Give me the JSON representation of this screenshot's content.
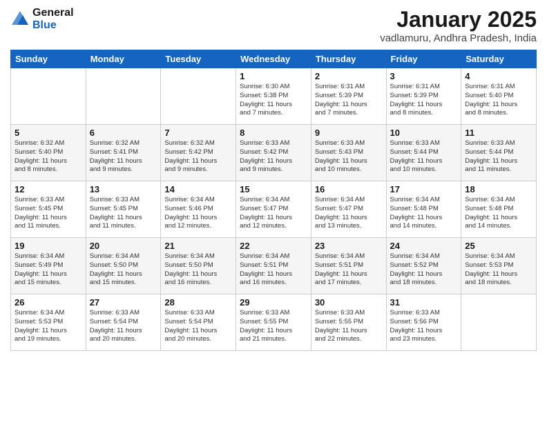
{
  "header": {
    "logo_line1": "General",
    "logo_line2": "Blue",
    "month": "January 2025",
    "location": "vadlamuru, Andhra Pradesh, India"
  },
  "weekdays": [
    "Sunday",
    "Monday",
    "Tuesday",
    "Wednesday",
    "Thursday",
    "Friday",
    "Saturday"
  ],
  "weeks": [
    [
      {
        "day": "",
        "info": ""
      },
      {
        "day": "",
        "info": ""
      },
      {
        "day": "",
        "info": ""
      },
      {
        "day": "1",
        "info": "Sunrise: 6:30 AM\nSunset: 5:38 PM\nDaylight: 11 hours\nand 7 minutes."
      },
      {
        "day": "2",
        "info": "Sunrise: 6:31 AM\nSunset: 5:39 PM\nDaylight: 11 hours\nand 7 minutes."
      },
      {
        "day": "3",
        "info": "Sunrise: 6:31 AM\nSunset: 5:39 PM\nDaylight: 11 hours\nand 8 minutes."
      },
      {
        "day": "4",
        "info": "Sunrise: 6:31 AM\nSunset: 5:40 PM\nDaylight: 11 hours\nand 8 minutes."
      }
    ],
    [
      {
        "day": "5",
        "info": "Sunrise: 6:32 AM\nSunset: 5:40 PM\nDaylight: 11 hours\nand 8 minutes."
      },
      {
        "day": "6",
        "info": "Sunrise: 6:32 AM\nSunset: 5:41 PM\nDaylight: 11 hours\nand 9 minutes."
      },
      {
        "day": "7",
        "info": "Sunrise: 6:32 AM\nSunset: 5:42 PM\nDaylight: 11 hours\nand 9 minutes."
      },
      {
        "day": "8",
        "info": "Sunrise: 6:33 AM\nSunset: 5:42 PM\nDaylight: 11 hours\nand 9 minutes."
      },
      {
        "day": "9",
        "info": "Sunrise: 6:33 AM\nSunset: 5:43 PM\nDaylight: 11 hours\nand 10 minutes."
      },
      {
        "day": "10",
        "info": "Sunrise: 6:33 AM\nSunset: 5:44 PM\nDaylight: 11 hours\nand 10 minutes."
      },
      {
        "day": "11",
        "info": "Sunrise: 6:33 AM\nSunset: 5:44 PM\nDaylight: 11 hours\nand 11 minutes."
      }
    ],
    [
      {
        "day": "12",
        "info": "Sunrise: 6:33 AM\nSunset: 5:45 PM\nDaylight: 11 hours\nand 11 minutes."
      },
      {
        "day": "13",
        "info": "Sunrise: 6:33 AM\nSunset: 5:45 PM\nDaylight: 11 hours\nand 11 minutes."
      },
      {
        "day": "14",
        "info": "Sunrise: 6:34 AM\nSunset: 5:46 PM\nDaylight: 11 hours\nand 12 minutes."
      },
      {
        "day": "15",
        "info": "Sunrise: 6:34 AM\nSunset: 5:47 PM\nDaylight: 11 hours\nand 12 minutes."
      },
      {
        "day": "16",
        "info": "Sunrise: 6:34 AM\nSunset: 5:47 PM\nDaylight: 11 hours\nand 13 minutes."
      },
      {
        "day": "17",
        "info": "Sunrise: 6:34 AM\nSunset: 5:48 PM\nDaylight: 11 hours\nand 14 minutes."
      },
      {
        "day": "18",
        "info": "Sunrise: 6:34 AM\nSunset: 5:48 PM\nDaylight: 11 hours\nand 14 minutes."
      }
    ],
    [
      {
        "day": "19",
        "info": "Sunrise: 6:34 AM\nSunset: 5:49 PM\nDaylight: 11 hours\nand 15 minutes."
      },
      {
        "day": "20",
        "info": "Sunrise: 6:34 AM\nSunset: 5:50 PM\nDaylight: 11 hours\nand 15 minutes."
      },
      {
        "day": "21",
        "info": "Sunrise: 6:34 AM\nSunset: 5:50 PM\nDaylight: 11 hours\nand 16 minutes."
      },
      {
        "day": "22",
        "info": "Sunrise: 6:34 AM\nSunset: 5:51 PM\nDaylight: 11 hours\nand 16 minutes."
      },
      {
        "day": "23",
        "info": "Sunrise: 6:34 AM\nSunset: 5:51 PM\nDaylight: 11 hours\nand 17 minutes."
      },
      {
        "day": "24",
        "info": "Sunrise: 6:34 AM\nSunset: 5:52 PM\nDaylight: 11 hours\nand 18 minutes."
      },
      {
        "day": "25",
        "info": "Sunrise: 6:34 AM\nSunset: 5:53 PM\nDaylight: 11 hours\nand 18 minutes."
      }
    ],
    [
      {
        "day": "26",
        "info": "Sunrise: 6:34 AM\nSunset: 5:53 PM\nDaylight: 11 hours\nand 19 minutes."
      },
      {
        "day": "27",
        "info": "Sunrise: 6:33 AM\nSunset: 5:54 PM\nDaylight: 11 hours\nand 20 minutes."
      },
      {
        "day": "28",
        "info": "Sunrise: 6:33 AM\nSunset: 5:54 PM\nDaylight: 11 hours\nand 20 minutes."
      },
      {
        "day": "29",
        "info": "Sunrise: 6:33 AM\nSunset: 5:55 PM\nDaylight: 11 hours\nand 21 minutes."
      },
      {
        "day": "30",
        "info": "Sunrise: 6:33 AM\nSunset: 5:55 PM\nDaylight: 11 hours\nand 22 minutes."
      },
      {
        "day": "31",
        "info": "Sunrise: 6:33 AM\nSunset: 5:56 PM\nDaylight: 11 hours\nand 23 minutes."
      },
      {
        "day": "",
        "info": ""
      }
    ]
  ]
}
